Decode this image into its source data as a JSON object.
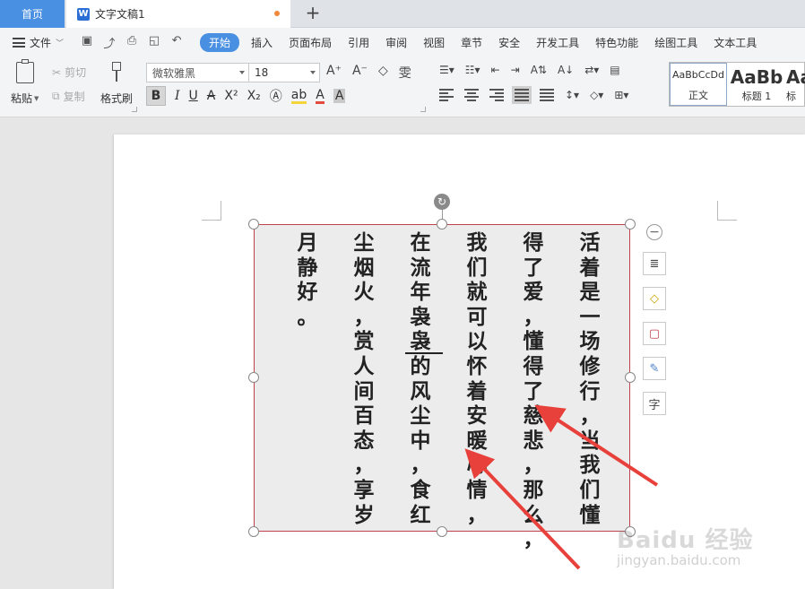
{
  "tabs": {
    "home": "首页",
    "doc_title": "文字文稿1",
    "add": "+"
  },
  "menubar": {
    "file": "文件",
    "items": [
      "开始",
      "插入",
      "页面布局",
      "引用",
      "审阅",
      "视图",
      "章节",
      "安全",
      "开发工具",
      "特色功能",
      "绘图工具",
      "文本工具"
    ],
    "active_index": 0
  },
  "ribbon": {
    "paste": "粘贴",
    "cut": "剪切",
    "copy": "复制",
    "format_painter": "格式刷",
    "font_name": "微软雅黑",
    "font_size": "18",
    "bold": "B",
    "italic": "I",
    "underline": "U",
    "styles": [
      {
        "preview": "AaBbCcDd",
        "label": "正文"
      },
      {
        "preview": "AaBb",
        "label": "标题 1"
      },
      {
        "preview": "Aa",
        "label": "标"
      }
    ]
  },
  "document": {
    "columns": [
      "活着是一场修行，当我们懂",
      "得了爱，懂得了慈悲，那么，",
      "我们就可以怀着安暖心情，",
      "在流年袅袅的风尘中，食红",
      "尘烟火，赏人间百态，享岁",
      "月静好。"
    ]
  },
  "side_tools": {
    "char_tool": "字"
  },
  "watermark": {
    "brand": "Baidu 经验",
    "url": "jingyan.baidu.com"
  },
  "colors": {
    "accent": "#4a90e2",
    "textbox_border": "#c0424a",
    "arrow": "#e8403a"
  }
}
